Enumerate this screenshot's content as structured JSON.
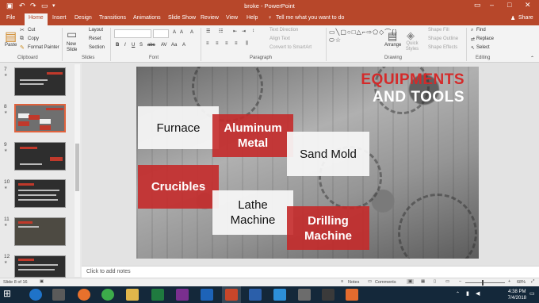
{
  "window": {
    "title": "broke - PowerPoint"
  },
  "tabs": [
    "File",
    "Home",
    "Insert",
    "Design",
    "Transitions",
    "Animations",
    "Slide Show",
    "Review",
    "View",
    "Help"
  ],
  "tell_me": "Tell me what you want to do",
  "share": "Share",
  "ribbon": {
    "clipboard": {
      "paste": "Paste",
      "cut": "Cut",
      "copy": "Copy",
      "format_painter": "Format Painter",
      "label": "Clipboard"
    },
    "slides": {
      "new_slide": "New Slide",
      "layout": "Layout",
      "reset": "Reset",
      "section": "Section",
      "label": "Slides"
    },
    "font": {
      "label": "Font"
    },
    "paragraph": {
      "text_direction": "Text Direction",
      "align_text": "Align Text",
      "convert": "Convert to SmartArt",
      "label": "Paragraph"
    },
    "drawing": {
      "arrange": "Arrange",
      "quick_styles": "Quick Styles",
      "shape_fill": "Shape Fill",
      "shape_outline": "Shape Outline",
      "shape_effects": "Shape Effects",
      "label": "Drawing"
    },
    "editing": {
      "find": "Find",
      "replace": "Replace",
      "select": "Select",
      "label": "Editing"
    }
  },
  "thumbnails": [
    {
      "num": "7"
    },
    {
      "num": "8"
    },
    {
      "num": "9"
    },
    {
      "num": "10"
    },
    {
      "num": "11"
    },
    {
      "num": "12"
    }
  ],
  "slide": {
    "title_line1": "EQUIPMENTS",
    "title_line2": "AND TOOLS",
    "boxes": {
      "furnace": "Furnace",
      "aluminum": "Aluminum Metal",
      "sand_mold": "Sand Mold",
      "crucibles": "Crucibles",
      "lathe": "Lathe Machine",
      "drilling": "Drilling Machine"
    }
  },
  "notes_placeholder": "Click to add notes",
  "status": {
    "slide_info": "Slide 8 of 16",
    "notes": "Notes",
    "comments": "Comments",
    "zoom": "68%"
  },
  "clock": {
    "time": "4:38 PM",
    "date": "7/4/2018"
  },
  "colors": {
    "accent": "#b7472a",
    "slide_red": "#c42a2a"
  }
}
